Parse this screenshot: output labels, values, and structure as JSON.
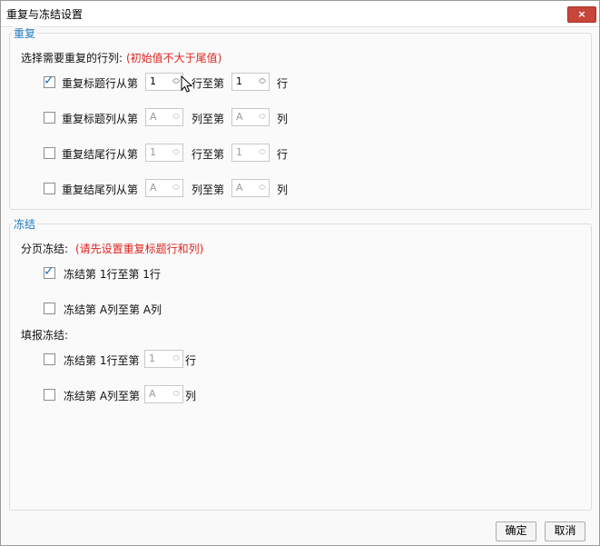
{
  "window": {
    "title": "重复与冻结设置",
    "close_label": "×"
  },
  "repeat": {
    "section_title": "重复",
    "prompt": "选择需要重复的行列:",
    "hint": "(初始值不大于尾值)",
    "rows": [
      {
        "checked": true,
        "label_from": "重复标题行从第",
        "from_value": "1",
        "label_to": "行至第",
        "to_value": "1",
        "unit": "行",
        "enabled": true
      },
      {
        "checked": false,
        "label_from": "重复标题列从第",
        "from_value": "A",
        "label_to": "列至第",
        "to_value": "A",
        "unit": "列",
        "enabled": false
      },
      {
        "checked": false,
        "label_from": "重复结尾行从第",
        "from_value": "1",
        "label_to": "行至第",
        "to_value": "1",
        "unit": "行",
        "enabled": false
      },
      {
        "checked": false,
        "label_from": "重复结尾列从第",
        "from_value": "A",
        "label_to": "列至第",
        "to_value": "A",
        "unit": "列",
        "enabled": false
      }
    ]
  },
  "freeze": {
    "section_title": "冻结",
    "paging_label": "分页冻结:",
    "paging_hint": "(请先设置重复标题行和列)",
    "paging_rows": [
      {
        "checked": true,
        "label": "冻结第 1行至第 1行"
      },
      {
        "checked": false,
        "label": "冻结第 A列至第 A列"
      }
    ],
    "fill_label": "填报冻结:",
    "fill_rows": [
      {
        "checked": false,
        "label": "冻结第 1行至第",
        "value": "1",
        "unit": "行"
      },
      {
        "checked": false,
        "label": "冻结第 A列至第",
        "value": "A",
        "unit": "列"
      }
    ]
  },
  "buttons": {
    "ok": "确定",
    "cancel": "取消"
  },
  "colors": {
    "accent": "#1e7bc4",
    "hint": "#e0241f",
    "check": "#1a72c9",
    "close": "#c7453a"
  }
}
